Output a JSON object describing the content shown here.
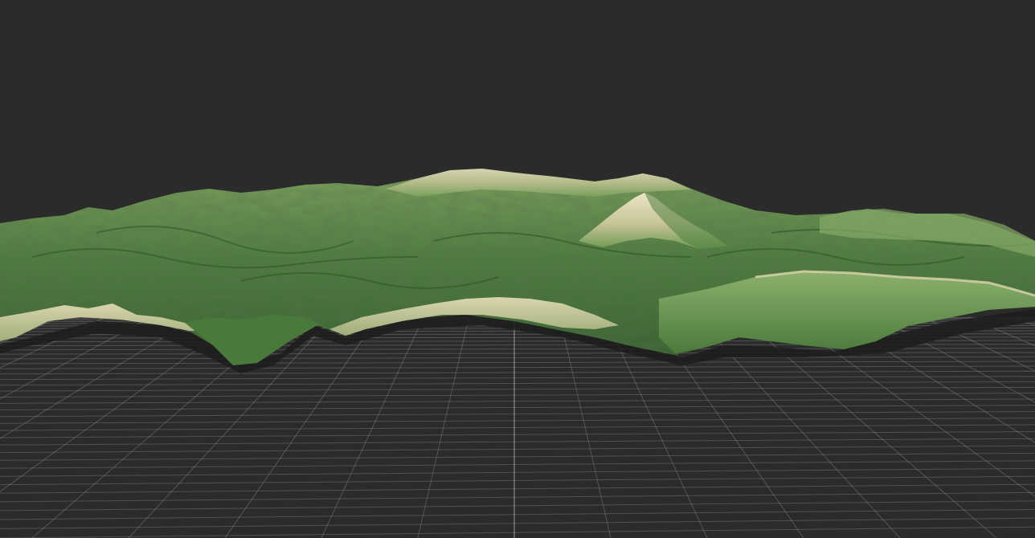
{
  "viewport": {
    "background_color": "#2b2b2b",
    "grid_line_color": "#8a8a8a",
    "grid_major_color": "#b8b8b8",
    "object": "terrain-mesh",
    "terrain_colors": {
      "lowland": "#3f6b35",
      "midland": "#5f8f4a",
      "highland": "#8aa767",
      "cliff": "#c9c596",
      "peak": "#e4dcc0",
      "shadow": "#1f1f1f"
    }
  }
}
